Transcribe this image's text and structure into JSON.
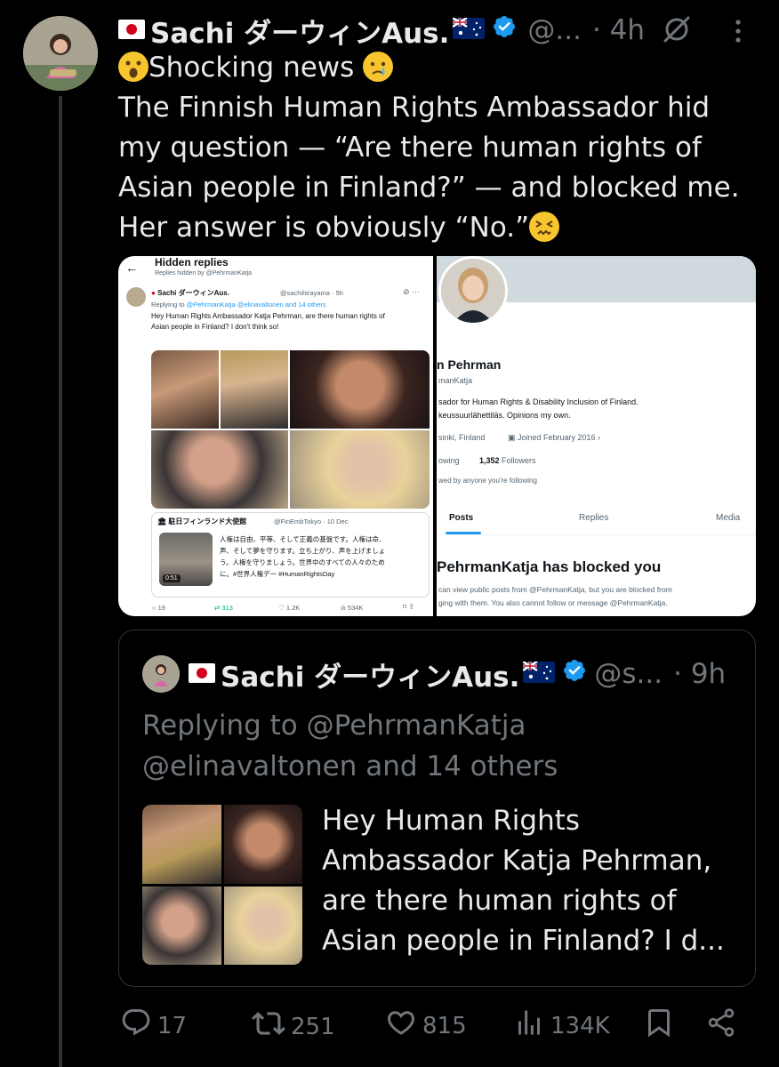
{
  "author": {
    "flag_prefix": "🇯🇵",
    "name": "Sachi ダーウィンAus.",
    "flag_suffix": "🇦🇺",
    "handle": "@...",
    "time": "· 4h"
  },
  "tweet": {
    "lines": [
      "Shocking news",
      "The Finnish Human Rights Ambassador hid",
      "my question — “Are there human rights of",
      "Asian people in Finland?” — and blocked me.",
      "Her answer is obviously “No.”"
    ]
  },
  "screenshot_left": {
    "title": "Hidden replies",
    "subtitle": "Replies hidden by @PehrmanKatja",
    "tweet_name": "Sachi ダーウィンAus.",
    "tweet_handle": "@sachihirayama · 5h",
    "replying_prefix": "Replying to",
    "replying_targets": "@PehrmanKatja @elinavaltonen and 14 others",
    "tweet_line1": "Hey Human Rights Ambassador Katja Pehrman, are there human rights of",
    "tweet_line2": "Asian people in Finland? I don't think so!",
    "embassy_name": "駐日フィンランド大使館",
    "embassy_handle": "@FinEmbTokyo · 10 Dec",
    "embassy_text1": "人権は自由、平等、そして正義の基盤です。人権は命、",
    "embassy_text2": "声、そして夢を守ります。立ち上がり、声を上げましょ",
    "embassy_text3": "う。人権を守りましょう。世界中のすべての人々のため",
    "embassy_text4": "に。#世界人権デー #HumanRightsDay",
    "video_duration": "0:51",
    "stat_replies": "19",
    "stat_reposts": "313",
    "stat_likes": "1.2K",
    "stat_views": "534K"
  },
  "screenshot_right": {
    "name": "n Pehrman",
    "handle": "manKatja",
    "bio1": "sador for Human Rights & Disability Inclusion of Finland.",
    "bio2": "keussuurlähettiläs. Opinions my own.",
    "location": "sinki, Finland",
    "joined": "Joined February 2016",
    "following": "owing",
    "followers_count": "1,352",
    "followers_label": "Followers",
    "followed_by": "wed by anyone you're following",
    "tabs": [
      "Posts",
      "Replies",
      "Media"
    ],
    "blocked_title": "PehrmanKatja has blocked you",
    "blocked_text1": "can view public posts from @PehrmanKatja, but you are blocked from",
    "blocked_text2": "ging with them. You also cannot follow or message @PehrmanKatja."
  },
  "quote": {
    "flag_prefix": "🇯🇵",
    "name": "Sachi ダーウィンAus.",
    "flag_suffix": "🇦🇺",
    "handle": "@s...",
    "time": "· 9h",
    "replying_line1": "Replying to @PehrmanKatja",
    "replying_line2": "@elinavaltonen and 14 others",
    "text_lines": [
      "Hey Human Rights",
      "Ambassador Katja Pehrman,",
      "are there human rights of",
      "Asian people in Finland? I d..."
    ]
  },
  "actions": {
    "replies": "17",
    "reposts": "251",
    "likes": "815",
    "views": "134K"
  },
  "colors": {
    "background": "#000000",
    "text": "#e7e9ea",
    "muted": "#71767b",
    "verified": "#1d9bf0",
    "border": "#2f3336"
  },
  "icons": [
    "verified-badge-icon",
    "grok-icon",
    "more-icon",
    "reply-icon",
    "repost-icon",
    "like-icon",
    "views-icon",
    "bookmark-icon",
    "share-icon"
  ]
}
